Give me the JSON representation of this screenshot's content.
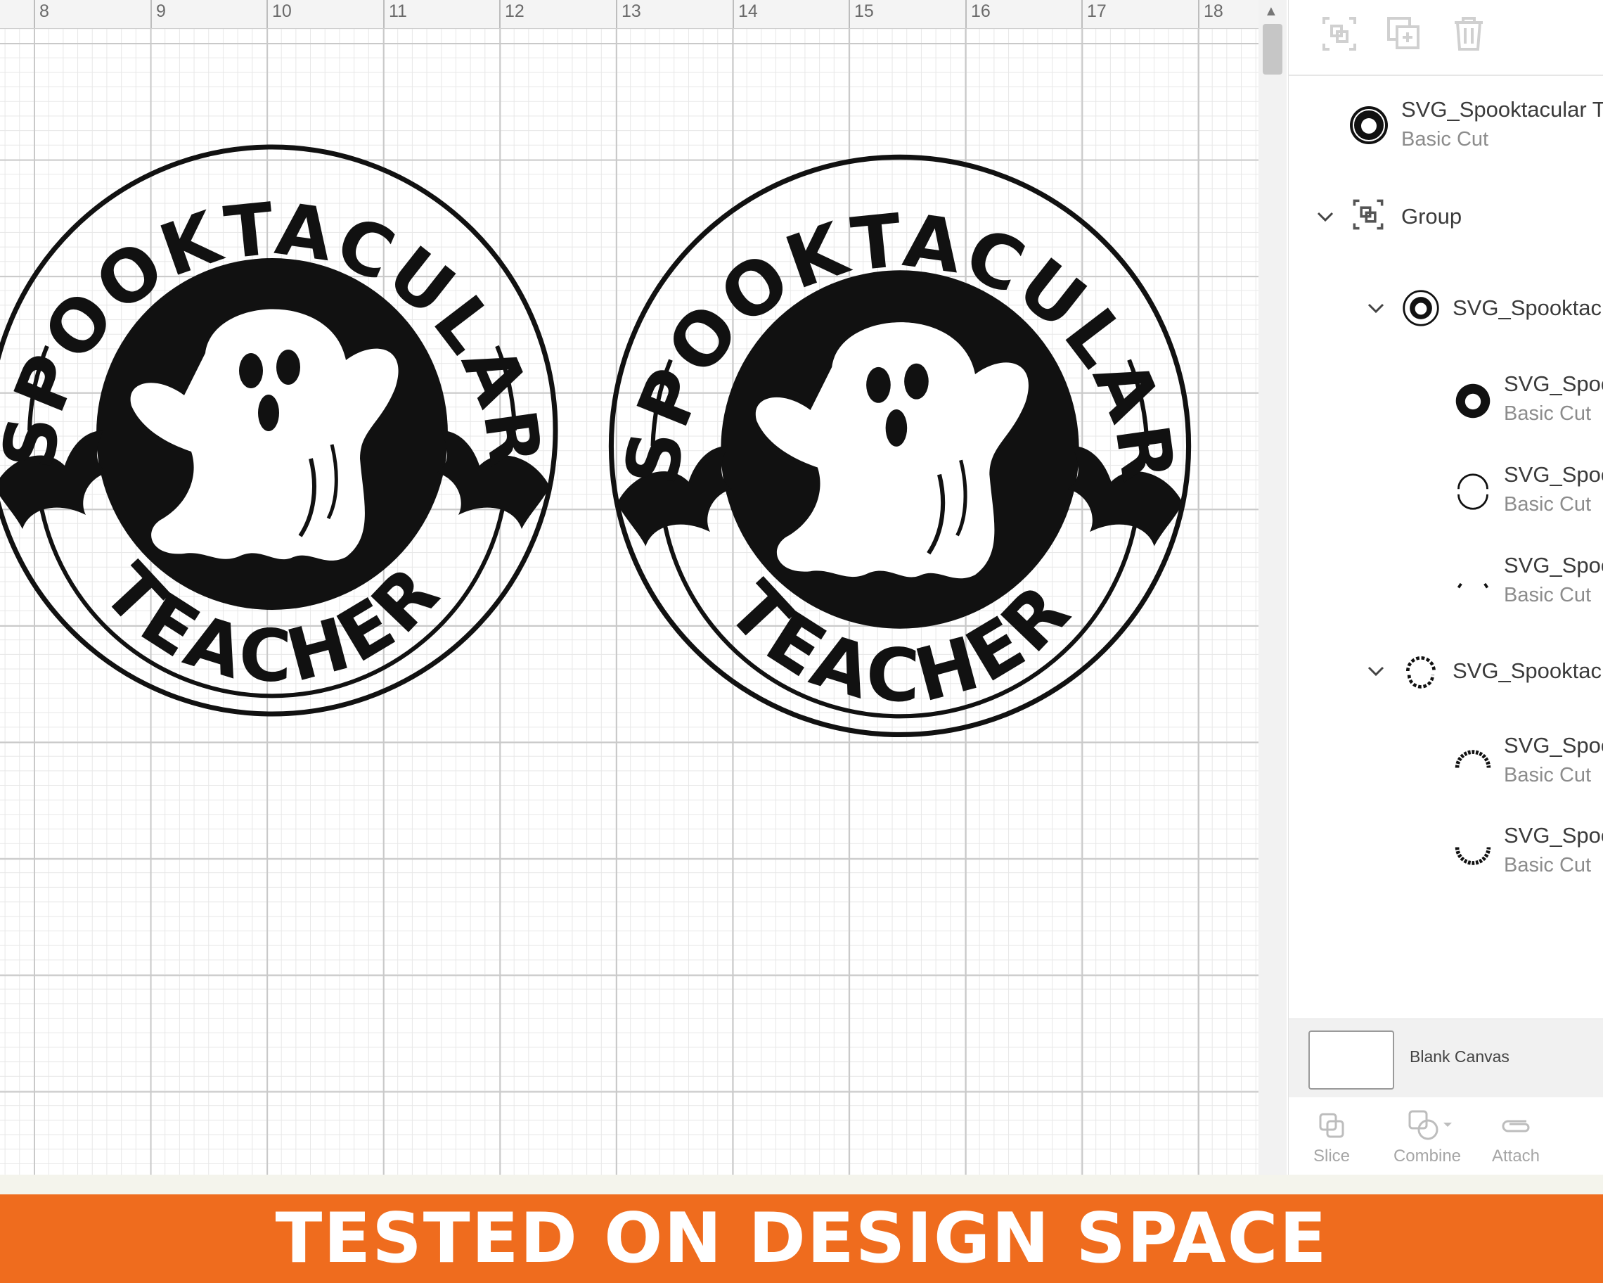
{
  "ruler": {
    "numbers": [
      "8",
      "9",
      "10",
      "11",
      "12",
      "13",
      "14",
      "15",
      "16",
      "17",
      "18"
    ]
  },
  "design": {
    "arc_text_top": "SPOOKTACULAR",
    "arc_text_bottom": "TEACHER"
  },
  "layers": {
    "items": [
      {
        "name": "SVG_Spooktacular T",
        "sub": "Basic Cut"
      },
      {
        "name": "Group",
        "sub": ""
      },
      {
        "name": "SVG_Spooktac",
        "sub": ""
      },
      {
        "name": "SVG_Spoo",
        "sub": "Basic Cut"
      },
      {
        "name": "SVG_Spoo",
        "sub": "Basic Cut"
      },
      {
        "name": "SVG_Spoo",
        "sub": "Basic Cut"
      },
      {
        "name": "SVG_Spooktac",
        "sub": ""
      },
      {
        "name": "SVG_Spoo",
        "sub": "Basic Cut"
      },
      {
        "name": "SVG_Spoo",
        "sub": "Basic Cut"
      }
    ]
  },
  "canvas_setting": {
    "label": "Blank Canvas"
  },
  "tools": {
    "slice": "Slice",
    "combine": "Combine",
    "attach": "Attach"
  },
  "banner": {
    "text": "TESTED ON DESIGN SPACE"
  },
  "colors": {
    "banner": "#ef6c1e",
    "ink": "#111111",
    "grid": "#c9c9c9"
  }
}
